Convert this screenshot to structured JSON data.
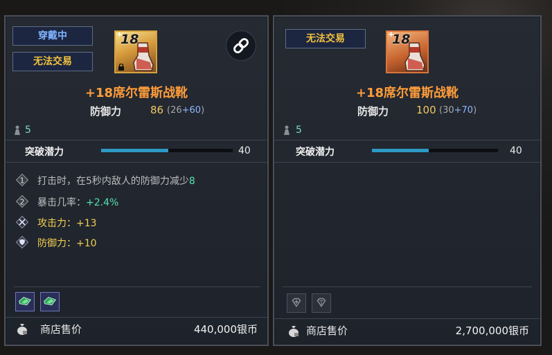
{
  "left": {
    "tag_equipped": "穿戴中",
    "tag_untradable": "无法交易",
    "item_level": "18",
    "item_level_plus": "+",
    "item_name": "+18席尔雷斯战靴",
    "defense_label": "防御力",
    "defense_value": "86",
    "defense_base": "26",
    "defense_bonus": "+60",
    "weight": "5",
    "potential_label": "突破潜力",
    "potential_value": "40",
    "potential_fill": 0.51,
    "effects": [
      {
        "badge": "1",
        "text": "打击时，在5秒内敌人的防御力减少",
        "value": "8"
      },
      {
        "badge": "2",
        "text": "暴击几率：",
        "value": "+2.4%"
      },
      {
        "icon": "swords-icon",
        "text": "攻击力：+13"
      },
      {
        "icon": "shield-icon",
        "text": "防御力：+10"
      }
    ],
    "gems": [
      "filled",
      "filled"
    ],
    "sell_label": "商店售价",
    "sell_value": "440,000银币"
  },
  "right": {
    "tag_untradable": "无法交易",
    "item_level": "18",
    "item_level_plus": "+",
    "item_name": "+18席尔雷斯战靴",
    "defense_label": "防御力",
    "defense_value": "100",
    "defense_base": "30",
    "defense_bonus": "+70",
    "weight": "5",
    "potential_label": "突破潜力",
    "potential_value": "40",
    "potential_fill": 0.45,
    "gems": [
      "empty",
      "empty"
    ],
    "sell_label": "商店售价",
    "sell_value": "2,700,000银币"
  },
  "colors": {
    "tag_blue": "#7fb2ff",
    "tag_gold": "#f3c23c",
    "item_name": "#ff9d3a",
    "defense_value": "#f0c860",
    "potential_bar": "#2c9ac4",
    "weight": "#7ed7c8"
  }
}
